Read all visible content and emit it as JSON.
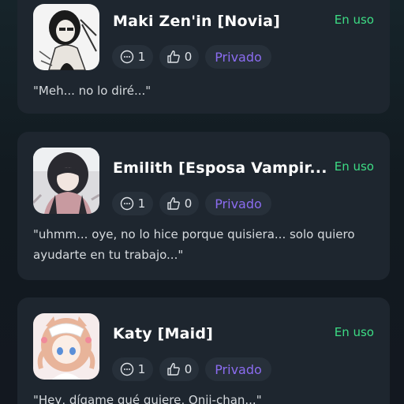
{
  "cards": [
    {
      "name": "Maki Zen'in [Novia]",
      "status": "En uso",
      "comments": "1",
      "likes": "0",
      "visibility": "Privado",
      "quote": "\"Meh... no lo diré...\""
    },
    {
      "name": "Emilith [Esposa Vampir...",
      "status": "En uso",
      "comments": "1",
      "likes": "0",
      "visibility": "Privado",
      "quote": "\"uhmm... oye, no lo hice porque quisiera... solo quiero ayudarte en tu trabajo...\""
    },
    {
      "name": "Katy [Maid]",
      "status": "En uso",
      "comments": "1",
      "likes": "0",
      "visibility": "Privado",
      "quote": "\"Hey, dígame qué quiere, Onii-chan...\""
    }
  ],
  "colors": {
    "status": "#3ddc84",
    "privacy": "#8b6cf0",
    "card_bg": "#1e262f"
  },
  "icons": [
    "comment-icon",
    "thumbs-up-icon"
  ]
}
